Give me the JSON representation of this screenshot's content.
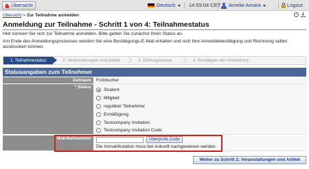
{
  "topbar": {
    "back_label": "Übersicht",
    "language": "Deutsch",
    "time": "14:59:04 CET",
    "user_name": "Amelie Amara",
    "logout_label": "Logout"
  },
  "breadcrumb": {
    "link": "Übersicht",
    "separator": " > ",
    "current": "Zur Teilnahme anmelden"
  },
  "page": {
    "title": "Anmeldung zur Teilnahme - Schritt 1 von 4: Teilnahmestatus",
    "intro_1": "Hier können Sie sich zur Teilnahme anmelden. Bitte geben Sie zunächst Ihren Status an.",
    "intro_2": "Am Ende des Anmeldungsprozesses werden Sie eine Bestätigungs-E-Mail erhalten und sich Ihre Anmeldebestätigung und Rechnung selbst ausdrucken können."
  },
  "steps": [
    "1. Teilnahmestatus",
    "2. Veranstaltungen und Artikel",
    "3. Zahlungsweise",
    "4. Bestätigen der Anmeldung"
  ],
  "section": {
    "title": "Statusangaben zum Teilnehmer"
  },
  "form": {
    "zeitraum_label": "Zeitraum",
    "zeitraum_value": "Frühbucher",
    "status_label": "* Status",
    "status_options": [
      "Student",
      "Mitglied",
      "regulärer Teilnehmer",
      "Ermäßigung",
      "Testcompany Invitation",
      "Testcompany Invitation Code"
    ],
    "status_selected": "Student",
    "matrikel_label": "Matrikelnummer",
    "matrikel_value": "",
    "check_button": "Überprüfe Code",
    "matrikel_note": "Die Immatrikulation muss bei Ankunft nachgewiesen werden."
  },
  "footer": {
    "next_button": "Weiter zu Schritt 2: Veranstaltungen und Artikel"
  },
  "colors": {
    "section_header": "#4a669a",
    "active_step": "#2b4b86",
    "label_bg": "#8d8d8d",
    "highlight_border": "#cc1f1f"
  }
}
